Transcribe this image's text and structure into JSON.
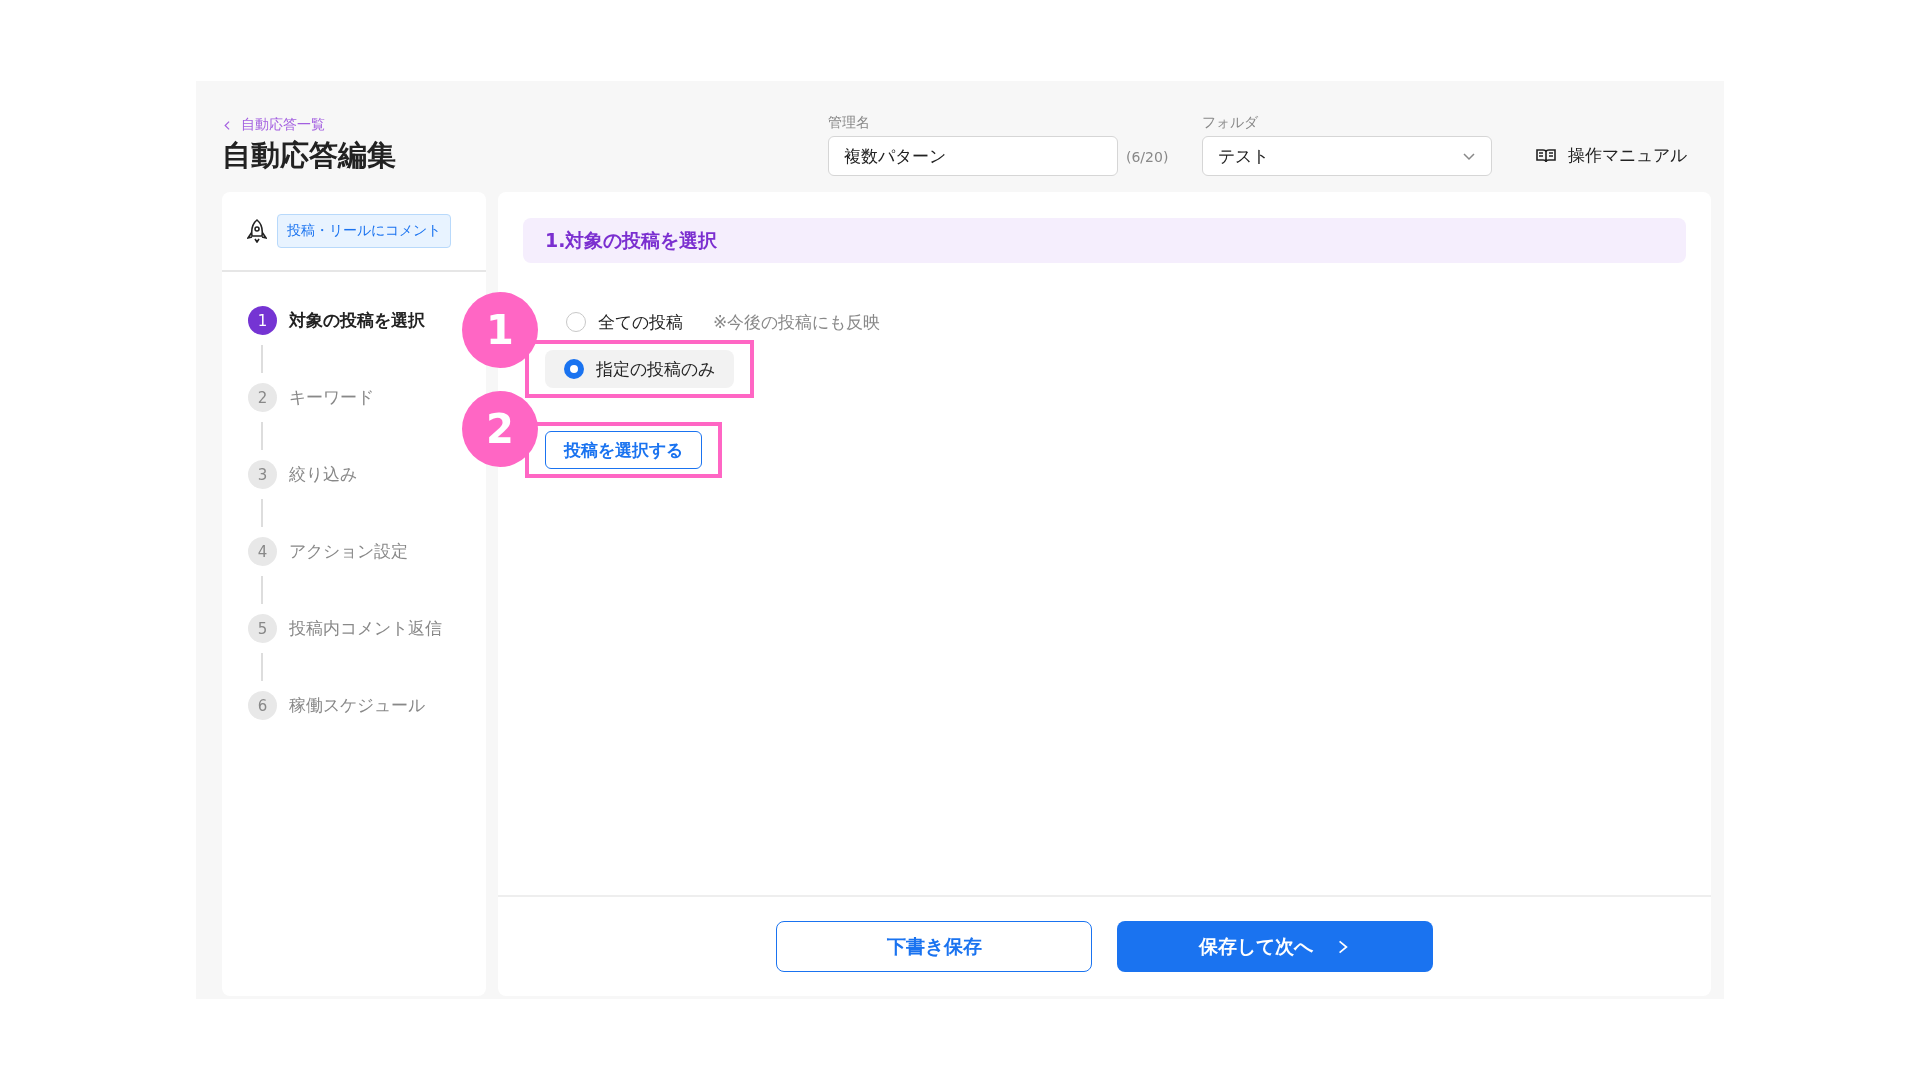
{
  "header": {
    "back_link": "自動応答一覧",
    "title": "自動応答編集",
    "name_field": {
      "label": "管理名",
      "value": "複数パターン",
      "counter": "(6/20)"
    },
    "folder_select": {
      "label": "フォルダ",
      "value": "テスト"
    },
    "manual_link": "操作マニュアル"
  },
  "sidebar": {
    "trigger_tag": "投稿・リールにコメント",
    "steps": [
      {
        "number": "1",
        "label": "対象の投稿を選択",
        "selected": true
      },
      {
        "number": "2",
        "label": "キーワード",
        "selected": false
      },
      {
        "number": "3",
        "label": "絞り込み",
        "selected": false
      },
      {
        "number": "4",
        "label": "アクション設定",
        "selected": false
      },
      {
        "number": "5",
        "label": "投稿内コメント返信",
        "selected": false
      },
      {
        "number": "6",
        "label": "稼働スケジュール",
        "selected": false
      }
    ]
  },
  "main": {
    "section_title": "1.対象の投稿を選択",
    "options": [
      {
        "label": "全ての投稿",
        "note": "※今後の投稿にも反映",
        "selected": false
      },
      {
        "label": "指定の投稿のみ",
        "selected": true
      }
    ],
    "select_posts_button": "投稿を選択する",
    "annotations": [
      {
        "label": "1"
      },
      {
        "label": "2"
      }
    ]
  },
  "footer": {
    "buttons": [
      {
        "kind": "outline",
        "label": "下書き保存"
      },
      {
        "kind": "primary",
        "label": "保存して次へ"
      }
    ]
  }
}
